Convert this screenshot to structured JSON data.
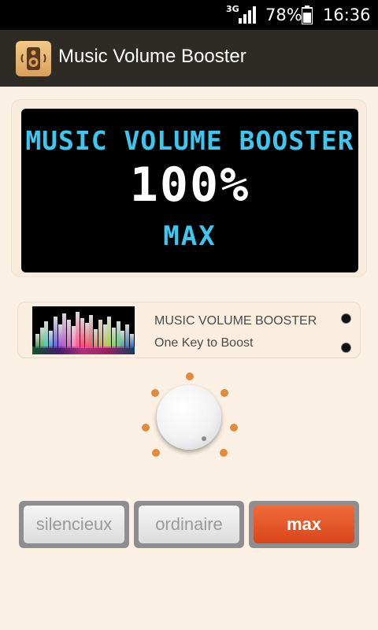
{
  "status_bar": {
    "network": "3G",
    "battery_percent": "78%",
    "time": "16:36"
  },
  "app": {
    "title": "Music Volume Booster"
  },
  "display": {
    "title": "MUSIC VOLUME BOOSTER",
    "volume_percent": "100%",
    "level": "MAX"
  },
  "info": {
    "line1": "MUSIC VOLUME BOOSTER",
    "line2": "One Key to Boost"
  },
  "buttons": {
    "silent": "silencieux",
    "ordinary": "ordinaire",
    "max": "max"
  },
  "colors": {
    "lcd_cyan": "#3ec7ee",
    "max_button": "#e8542a",
    "tick_orange": "#e48a3c"
  }
}
